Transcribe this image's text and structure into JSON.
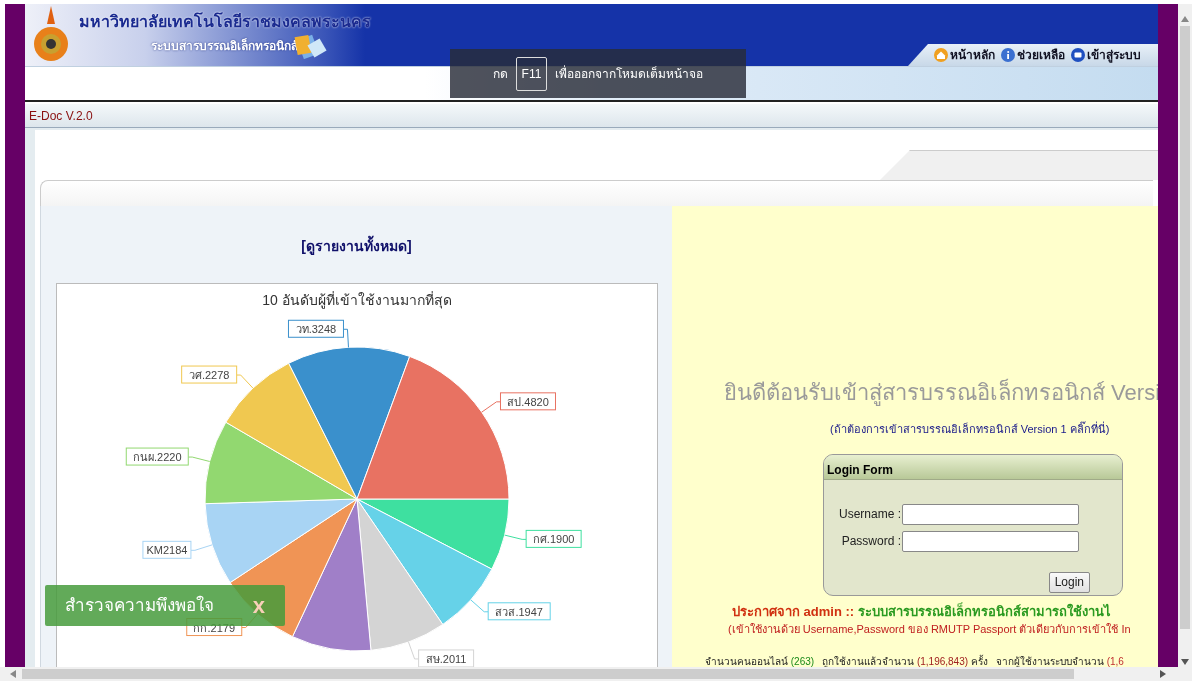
{
  "header": {
    "university": "มหาวิทยาลัยเทคโนโลยีราชมงคลพระนคร",
    "system": "ระบบสารบรรณอิเล็กทรอนิกส์",
    "nav": [
      {
        "label": "หน้าหลัก",
        "kind": "home"
      },
      {
        "label": "ช่วยเหลือ",
        "kind": "help"
      },
      {
        "label": "เข้าสู่ระบบ",
        "kind": "login"
      }
    ]
  },
  "fullscreen_notice": {
    "before": "กด",
    "key": "F11",
    "after": "เพื่อออกจากโหมดเต็มหน้าจอ"
  },
  "version_bar": "E-Doc V.2.0",
  "report_link": "[ดูรายงานทั้งหมด]",
  "chart": {
    "chart_data": {
      "type": "pie",
      "title": "10 อันดับผู้ที่เข้าใช้งานมากที่สุด",
      "categories": [
        "กศ.1900",
        "สวส.1947",
        "สษ.2011",
        null,
        "กก.2179",
        "KM2184",
        "กนผ.2220",
        "วศ.2278",
        "วท.3248",
        "สป.4820"
      ],
      "values": [
        1900,
        1947,
        2011,
        2100,
        2179,
        2184,
        2220,
        2278,
        3248,
        4820
      ],
      "colors": [
        "#3ee0a0",
        "#66d2e8",
        "#d4d4d4",
        "#a07fc8",
        "#f09455",
        "#a8d4f4",
        "#92d870",
        "#f0c850",
        "#3a90cc",
        "#e87262"
      ]
    }
  },
  "survey_button": {
    "label": "สำรวจความพึงพอใจ",
    "close": "x"
  },
  "welcome": "ยินดีต้อนรับเข้าสู่สารบรรณอิเล็กทรอนิกส์ Versi",
  "version1_link": "(ถ้าต้องการเข้าสารบรรณอิเล็กทรอนิกส์ Version 1 คลิ๊กที่นี่)",
  "login_form": {
    "title": "Login Form",
    "fields": [
      {
        "label": "Username :"
      },
      {
        "label": "Password :"
      }
    ],
    "button": "Login"
  },
  "announcement": {
    "source": "ประกาศจาก admin ::",
    "message": "ระบบสารบรรณอิเล็กทรอนิกส์สามารถใช้งานไ",
    "note": "(เข้าใช้งานด้วย Username,Password ของ RMUTP Passport ตัวเดียวกับการเข้าใช้ In"
  },
  "stats": [
    {
      "label": "จำนวนคนออนไลน์",
      "value": "(263)",
      "kind": "online"
    },
    {
      "label": "ถูกใช้งานแล้วจำนวน",
      "value": "(1,196,843)",
      "suffix": "ครั้ง",
      "kind": "usage"
    },
    {
      "label": "จากผู้ใช้งานระบบจำนวน",
      "value": "(1,6",
      "kind": "users"
    }
  ]
}
